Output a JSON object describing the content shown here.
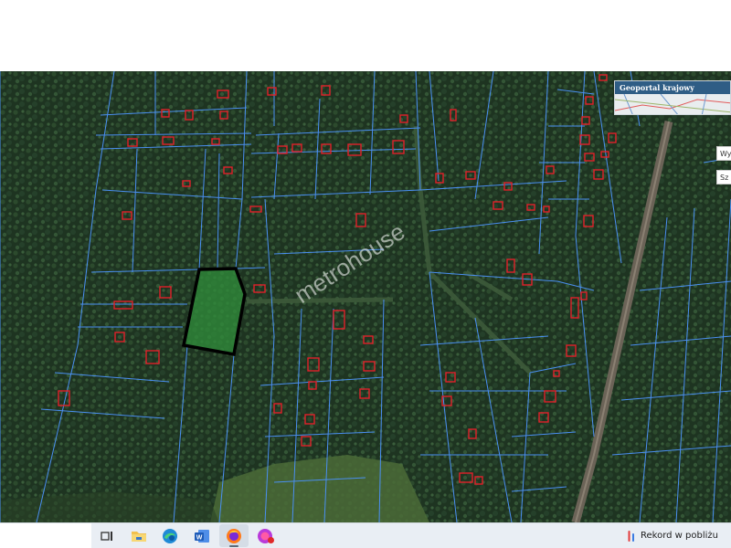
{
  "map": {
    "watermark": "metrohouse",
    "colors": {
      "forest": "#1d3120",
      "parcel_lines": "#4c8ff0",
      "buildings": "#e0202a",
      "highlight_fill": "#2f8a3a",
      "highlight_border": "#000000",
      "railway": "#6a6256",
      "meadow": "#4e6e38"
    }
  },
  "minimap": {
    "title": "Geoportal krajowy"
  },
  "side_tabs": [
    "Wy",
    "Sz"
  ],
  "taskbar": {
    "apps": [
      {
        "name": "task-view-icon",
        "active": false
      },
      {
        "name": "file-explorer-icon",
        "active": false
      },
      {
        "name": "edge-browser-icon",
        "active": false
      },
      {
        "name": "word-icon",
        "active": false
      },
      {
        "name": "firefox-icon",
        "active": true
      },
      {
        "name": "firefox-private-icon",
        "active": false
      }
    ],
    "tray": {
      "icon": "recording-indicator-icon",
      "label": "Rekord w pobliżu"
    }
  }
}
